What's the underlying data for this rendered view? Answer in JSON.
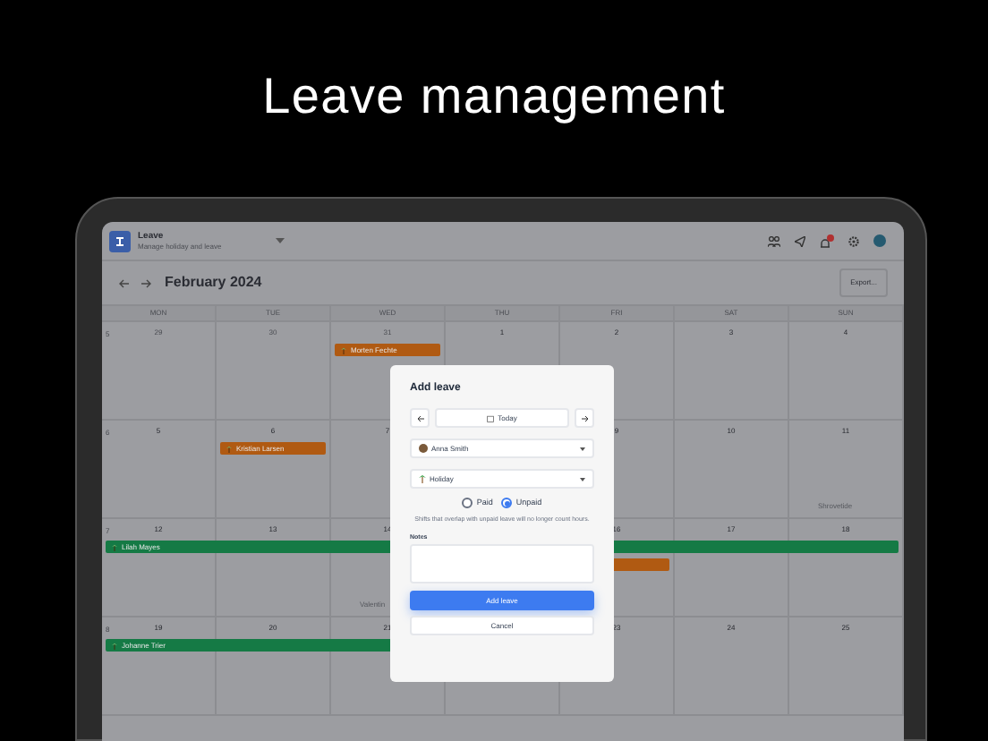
{
  "headline": "Leave management",
  "app": {
    "title": "Leave",
    "subtitle": "Manage holiday and leave"
  },
  "calendar": {
    "month": "February 2024",
    "export_button": "Export...",
    "weekdays": [
      "MON",
      "TUE",
      "WED",
      "THU",
      "FRI",
      "SAT",
      "SUN"
    ],
    "weeks": [
      {
        "number": "5",
        "days": [
          {
            "date": "29",
            "outside": true
          },
          {
            "date": "30",
            "outside": true
          },
          {
            "date": "31",
            "outside": true,
            "events": [
              {
                "label": "Morten Fechte",
                "color": "#b05a12"
              }
            ]
          },
          {
            "date": "1",
            "outside": false
          },
          {
            "date": "2",
            "outside": false
          },
          {
            "date": "3",
            "outside": false
          },
          {
            "date": "4",
            "outside": false
          }
        ]
      },
      {
        "number": "6",
        "days_left": [
          {
            "date": "5",
            "outside": false
          },
          {
            "date": "6",
            "outside": false,
            "events": [
              {
                "label": "Kristian Larsen",
                "color": "#b05a12"
              }
            ]
          },
          {
            "date": "7",
            "outside": false
          }
        ],
        "days_right": [
          {
            "date": "9",
            "outside": false
          },
          {
            "date": "10",
            "outside": false
          },
          {
            "date": "11",
            "outside": false,
            "holiday": "Shrovetide"
          }
        ]
      },
      {
        "number": "7",
        "days_left": [
          {
            "date": "12",
            "outside": false,
            "events": [
              {
                "label": "Lilah Mayes",
                "color": "#157a45"
              }
            ]
          },
          {
            "date": "13",
            "outside": false,
            "events": [
              {
                "color": "#157a45"
              }
            ]
          },
          {
            "date": "14",
            "outside": false,
            "holiday": "Valentin",
            "events": [
              {
                "color": "#157a45"
              }
            ]
          }
        ],
        "days_right": [
          {
            "date": "16",
            "outside": false,
            "events": [
              {
                "color": "#157a45"
              },
              {
                "color": "#b05a12"
              }
            ]
          },
          {
            "date": "17",
            "outside": false,
            "events": [
              {
                "color": "#157a45"
              }
            ]
          },
          {
            "date": "18",
            "outside": false,
            "events": [
              {
                "color": "#157a45"
              }
            ]
          }
        ]
      },
      {
        "number": "8",
        "days_left": [
          {
            "date": "19",
            "outside": false,
            "events": [
              {
                "label": "Johanne Trier",
                "color": "#157a45"
              }
            ]
          },
          {
            "date": "20",
            "outside": false,
            "events": [
              {
                "color": "#157a45"
              }
            ]
          },
          {
            "date": "21",
            "outside": false,
            "events": [
              {
                "color": "#157a45"
              }
            ]
          }
        ],
        "days_right": [
          {
            "date": "23",
            "outside": false
          },
          {
            "date": "24",
            "outside": false
          },
          {
            "date": "25",
            "outside": false
          }
        ]
      }
    ]
  },
  "dialog": {
    "title": "Add leave",
    "date": "Today",
    "employee": "Anna Smith",
    "leave_type": "Holiday",
    "pay_options": [
      {
        "label": "Paid",
        "selected": false
      },
      {
        "label": "Unpaid",
        "selected": true
      }
    ],
    "hint": "Shifts that overlap with unpaid leave will no longer count hours.",
    "notes_label": "Notes",
    "submit_button": "Add leave",
    "cancel_button": "Cancel"
  }
}
